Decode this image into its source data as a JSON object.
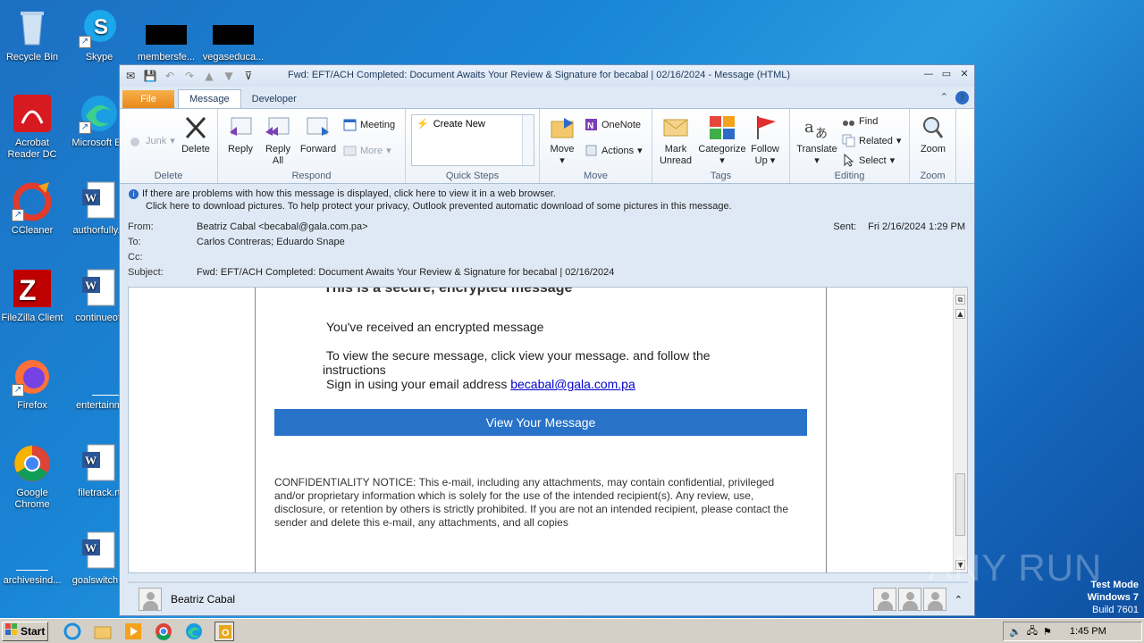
{
  "desktop": {
    "icons": [
      {
        "label": "Recycle Bin"
      },
      {
        "label": "Skype"
      },
      {
        "label": "membersfe..."
      },
      {
        "label": "vegaseduca..."
      },
      {
        "label": "Acrobat Reader DC"
      },
      {
        "label": "Microsoft Ed"
      },
      {
        "label": "CCleaner"
      },
      {
        "label": "authorfully..."
      },
      {
        "label": "FileZilla Client"
      },
      {
        "label": "continueoff"
      },
      {
        "label": "Firefox"
      },
      {
        "label": "entertainm"
      },
      {
        "label": "Google Chrome"
      },
      {
        "label": "filetrack.rt"
      },
      {
        "label": "archivesind..."
      },
      {
        "label": "goalswitch..."
      }
    ]
  },
  "window": {
    "title": "Fwd: EFT/ACH Completed: Document Awaits Your Review & Signature for becabal | 02/16/2024  -  Message (HTML)"
  },
  "tabs": {
    "file": "File",
    "message": "Message",
    "developer": "Developer"
  },
  "ribbon": {
    "delete_group": {
      "label": "Delete",
      "junk": "Junk",
      "delete": "Delete"
    },
    "respond_group": {
      "label": "Respond",
      "reply": "Reply",
      "reply_all_1": "Reply",
      "reply_all_2": "All",
      "forward": "Forward",
      "meeting": "Meeting",
      "more": "More"
    },
    "quick_steps_group": {
      "label": "Quick Steps",
      "create_new": "Create New"
    },
    "move_group": {
      "label": "Move",
      "move": "Move",
      "onenote": "OneNote",
      "actions": "Actions"
    },
    "tags_group": {
      "label": "Tags",
      "mark_unread_1": "Mark",
      "mark_unread_2": "Unread",
      "categorize": "Categorize",
      "follow_up_1": "Follow",
      "follow_up_2": "Up"
    },
    "editing_group": {
      "label": "Editing",
      "translate": "Translate",
      "find": "Find",
      "related": "Related",
      "select": "Select"
    },
    "zoom_group": {
      "label": "Zoom",
      "zoom": "Zoom"
    }
  },
  "infobar": {
    "line1": "If there are problems with how this message is displayed, click here to view it in a web browser.",
    "line2": "Click here to download pictures. To help protect your privacy, Outlook prevented automatic download of some pictures in this message."
  },
  "headers": {
    "from_label": "From:",
    "from_value": "Beatriz Cabal <becabal@gala.com.pa>",
    "to_label": "To:",
    "to_value": "Carlos Contreras; Eduardo Snape",
    "cc_label": "Cc:",
    "cc_value": "",
    "subject_label": "Subject:",
    "subject_value": "Fwd: EFT/ACH Completed: Document Awaits Your Review & Signature for becabal | 02/16/2024",
    "sent_label": "Sent:",
    "sent_value": "Fri 2/16/2024 1:29 PM"
  },
  "message": {
    "heading": "This is a secure, encrypted message",
    "received": "You've received an encrypted message",
    "instructions_1": "To view the secure message, click view your message. and follow the",
    "instructions_2": "instructions",
    "sign_in": "Sign in using your email address",
    "email": "becabal@gala.com.pa",
    "button": "View Your Message",
    "confidentiality_1": "CONFIDENTIALITY NOTICE: This e-mail, including any attachments, may contain confidential, privileged",
    "confidentiality_2": "and/or proprietary information which is solely for the use of the intended recipient(s). Any review, use,",
    "confidentiality_3": "disclosure, or retention by others is strictly prohibited. If you are not an intended recipient, please contact the",
    "confidentiality_4": "sender and delete this e-mail, any attachments, and all copies"
  },
  "people_pane": {
    "name": "Beatriz Cabal"
  },
  "taskbar": {
    "start": "Start",
    "time": "1:45 PM"
  },
  "watermark": {
    "line1": "Test Mode",
    "line2": "Windows 7",
    "line3": "Build 7601",
    "brand": "ANY RUN"
  },
  "colors": {
    "button_blue": "#2872c8",
    "link_blue": "#0000cc",
    "file_tab": "#e8881b"
  }
}
